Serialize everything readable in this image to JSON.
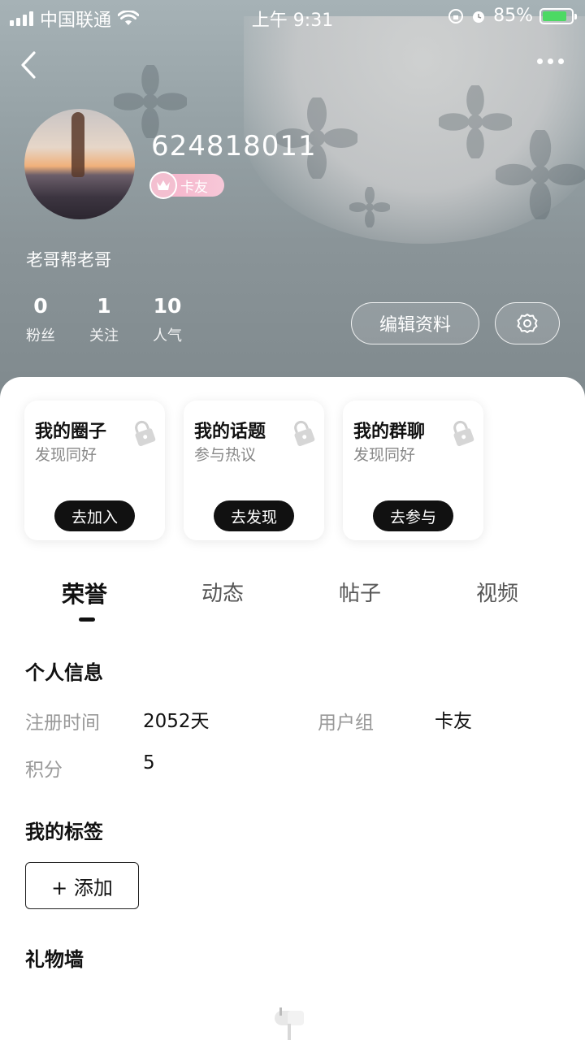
{
  "status_bar": {
    "carrier": "中国联通",
    "time": "上午 9:31",
    "battery": "85%",
    "battery_level": 0.85
  },
  "profile": {
    "username": "624818011",
    "badge": "卡友",
    "bio": "老哥帮老哥",
    "stats": [
      {
        "value": "0",
        "label": "粉丝"
      },
      {
        "value": "1",
        "label": "关注"
      },
      {
        "value": "10",
        "label": "人气"
      }
    ],
    "edit_button": "编辑资料"
  },
  "cards": [
    {
      "title": "我的圈子",
      "subtitle": "发现同好",
      "button": "去加入"
    },
    {
      "title": "我的话题",
      "subtitle": "参与热议",
      "button": "去发现"
    },
    {
      "title": "我的群聊",
      "subtitle": "发现同好",
      "button": "去参与"
    }
  ],
  "tabs": [
    "荣誉",
    "动态",
    "帖子",
    "视频"
  ],
  "active_tab": "荣誉",
  "personal_info": {
    "title": "个人信息",
    "register_label": "注册时间",
    "register_value": "2052天",
    "group_label": "用户组",
    "group_value": "卡友",
    "points_label": "积分",
    "points_value": "5"
  },
  "tags": {
    "title": "我的标签",
    "add_button": "+ 添加"
  },
  "gifts": {
    "title": "礼物墙"
  },
  "icons": [
    "back-icon",
    "more-icon",
    "crown-icon",
    "settings-icon",
    "lock-icon",
    "mailbox-icon"
  ]
}
